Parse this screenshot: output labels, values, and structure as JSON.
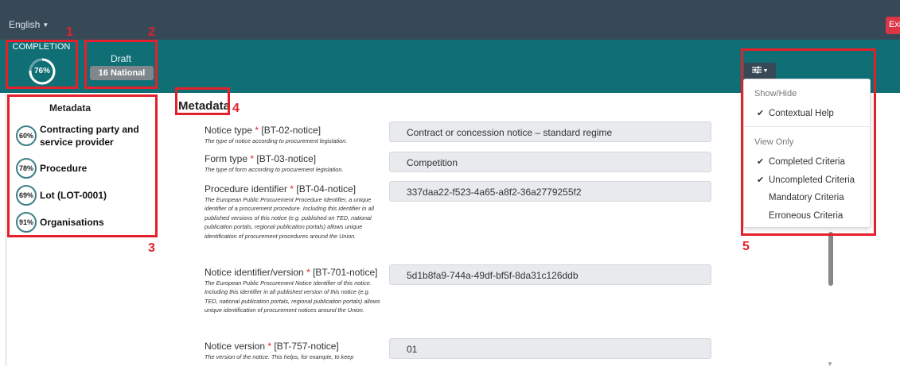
{
  "topbar": {
    "language": "English",
    "exit_label": "Exit"
  },
  "status": {
    "completion_label": "COMPLETION",
    "completion_percent": "76%",
    "completion_fraction": 0.76,
    "draft_label": "Draft",
    "notice_badge": "16 National"
  },
  "sidebar": {
    "title": "Metadata",
    "items": [
      {
        "percent": "60%",
        "label": "Contracting party and service provider"
      },
      {
        "percent": "78%",
        "label": "Procedure"
      },
      {
        "percent": "69%",
        "label": "Lot (LOT-0001)"
      },
      {
        "percent": "91%",
        "label": "Organisations"
      }
    ]
  },
  "main": {
    "heading": "Metadata",
    "fields": [
      {
        "label": "Notice type",
        "code": "[BT-02-notice]",
        "help": "The type of notice according to procurement legislation.",
        "value": "Contract or concession notice – standard regime"
      },
      {
        "label": "Form type",
        "code": "[BT-03-notice]",
        "help": "The type of form according to procurement legislation.",
        "value": "Competition"
      },
      {
        "label": "Procedure identifier",
        "code": "[BT-04-notice]",
        "help": "The European Public Procurement Procedure Identifier, a unique identifier of a procurement procedure. Including this identifier in all published versions of this notice (e.g. published on TED, national publication portals, regional publication portals) allows unique identification of procurement procedures around the Union.",
        "value": "337daa22-f523-4a65-a8f2-36a2779255f2"
      },
      {
        "label": "Notice identifier/version",
        "code": "[BT-701-notice]",
        "help": "The European Public Procurement Notice Identifier of this notice. Including this identifier in all published version of this notice (e.g. TED, national publication portals, regional publication portals) allows unique identification of procurement notices around the Union.",
        "value": "5d1b8fa9-744a-49df-bf5f-8da31c126ddb"
      },
      {
        "label": "Notice version",
        "code": "[BT-757-notice]",
        "help": "The version of the notice. This helps, for example, to keep",
        "value": "01"
      }
    ],
    "required_marker": "*"
  },
  "settings_menu": {
    "show_hide_header": "Show/Hide",
    "contextual_help": "Contextual Help",
    "view_only_header": "View Only",
    "completed_criteria": "Completed Criteria",
    "uncompleted_criteria": "Uncompleted Criteria",
    "mandatory_criteria": "Mandatory Criteria",
    "erroneous_criteria": "Erroneous Criteria",
    "check_glyph": "✔"
  },
  "annotations": {
    "n1": "1",
    "n2": "2",
    "n3": "3",
    "n4": "4",
    "n5": "5"
  },
  "colors": {
    "topbar": "#374957",
    "tealbar": "#0f6f75",
    "annotation_red": "#e3202b",
    "exit_red": "#dc3545"
  },
  "icons": {
    "settings": "sliders-icon",
    "dropdown_caret": "caret-down-icon",
    "check": "check-icon"
  }
}
